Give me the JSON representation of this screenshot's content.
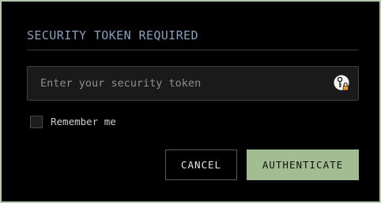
{
  "dialog": {
    "title": "SECURITY TOKEN REQUIRED"
  },
  "token_input": {
    "placeholder": "Enter your security token",
    "value": "",
    "icon": "key-lock-icon"
  },
  "remember": {
    "label": "Remember me",
    "checked": false
  },
  "buttons": {
    "cancel_label": "CANCEL",
    "authenticate_label": "AUTHENTICATE"
  },
  "colors": {
    "frame_border": "#b7c7ae",
    "background": "#000000",
    "title": "#8c9fbc",
    "accent": "#a2bd92",
    "field_background": "#1a1a1a"
  }
}
